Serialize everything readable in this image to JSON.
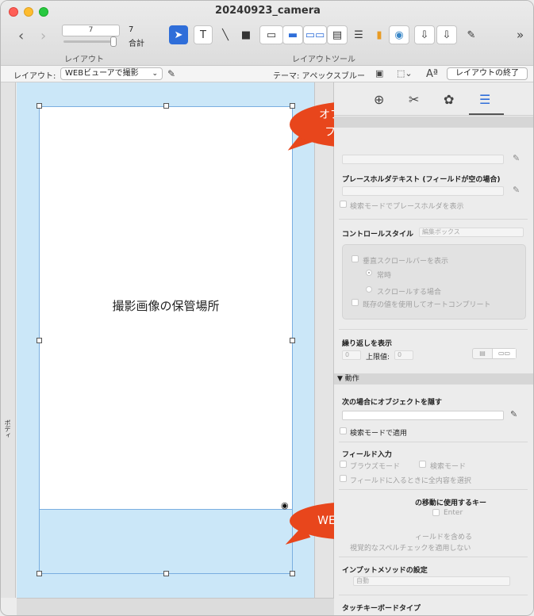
{
  "window": {
    "title": "20240923_camera"
  },
  "toolbar": {
    "layout_number": "7",
    "total_count": "7",
    "total_label": "合計",
    "layout_caption": "レイアウト",
    "layout_tools_caption": "レイアウトツール",
    "tools": [
      "pointer-tool",
      "text-tool",
      "line-tool",
      "shape-tool",
      "field-tool",
      "button-tool",
      "button-bar-tool",
      "popover-tool",
      "portal-tool",
      "chart-tool",
      "webviewer-tool",
      "insert-field-tool",
      "insert-part-tool",
      "format-painter-tool"
    ]
  },
  "layout_bar": {
    "layout_label": "レイアウト:",
    "layout_select": "WEBビューアで撮影",
    "theme": "テーマ: アペックスブルー",
    "end_layout_button": "レイアウトの終了"
  },
  "canvas": {
    "part_label": "ボディ",
    "webviewer_text": "撮影画像の保管場所"
  },
  "callouts": {
    "object_field": [
      "オブジェクト",
      "フィールド"
    ],
    "web_viewer": "WEBビューア"
  },
  "inspector": {
    "placeholder_label": "プレースホルダテキスト (フィールドが空の場合)",
    "placeholder_find_mode": "検索モードでプレースホルダを表示",
    "control_style_label": "コントロールスタイル",
    "control_style_value": "編集ボックス",
    "vertical_scrollbar": "垂直スクロールバーを表示",
    "always": "常時",
    "when_scrolling": "スクロールする場合",
    "autocomplete": "既存の値を使用してオートコンプリート",
    "repeat_label": "繰り返しを表示",
    "repeat_value": "0",
    "max_label": "上限値:",
    "max_value": "0",
    "behavior_section": "▼ 動作",
    "hide_object_label": "次の場合にオブジェクトを隠す",
    "apply_find_mode": "検索モードで適用",
    "field_entry_label": "フィールド入力",
    "browse_mode": "ブラウズモード",
    "find_mode": "検索モード",
    "select_entire": "フィールドに入るときに全内容を選択",
    "keys_label": "の移動に使用するキー",
    "enter_key": "Enter",
    "include_field": "ィールドを含める",
    "no_spellcheck": "視覚的なスペルチェックを適用しない",
    "input_method_label": "インプットメソッドの設定",
    "input_method_value": "自動",
    "touch_keyboard_label": "タッチキーボードタイプ"
  }
}
